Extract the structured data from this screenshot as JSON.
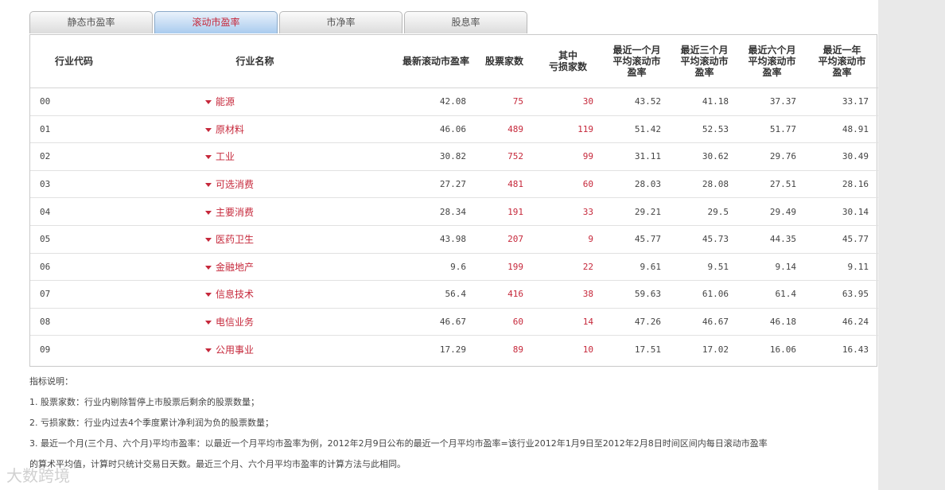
{
  "tabs": [
    {
      "label": "静态市盈率",
      "active": false
    },
    {
      "label": "滚动市盈率",
      "active": true
    },
    {
      "label": "市净率",
      "active": false
    },
    {
      "label": "股息率",
      "active": false
    }
  ],
  "table": {
    "headers": {
      "code": "行业代码",
      "name": "行业名称",
      "latest_pe": "最新滚动市盈率",
      "stock_count": "股票家数",
      "loss_count_1": "其中",
      "loss_count_2": "亏损家数",
      "m1_1": "最近一个月",
      "m1_2": "平均滚动市",
      "m1_3": "盈率",
      "m3_1": "最近三个月",
      "m3_2": "平均滚动市",
      "m3_3": "盈率",
      "m6_1": "最近六个月",
      "m6_2": "平均滚动市",
      "m6_3": "盈率",
      "y1_1": "最近一年",
      "y1_2": "平均滚动市",
      "y1_3": "盈率"
    },
    "rows": [
      {
        "code": "00",
        "name": "能源",
        "pe": "42.08",
        "count": "75",
        "loss": "30",
        "m1": "43.52",
        "m3": "41.18",
        "m6": "37.37",
        "y1": "33.17"
      },
      {
        "code": "01",
        "name": "原材料",
        "pe": "46.06",
        "count": "489",
        "loss": "119",
        "m1": "51.42",
        "m3": "52.53",
        "m6": "51.77",
        "y1": "48.91"
      },
      {
        "code": "02",
        "name": "工业",
        "pe": "30.82",
        "count": "752",
        "loss": "99",
        "m1": "31.11",
        "m3": "30.62",
        "m6": "29.76",
        "y1": "30.49"
      },
      {
        "code": "03",
        "name": "可选消费",
        "pe": "27.27",
        "count": "481",
        "loss": "60",
        "m1": "28.03",
        "m3": "28.08",
        "m6": "27.51",
        "y1": "28.16"
      },
      {
        "code": "04",
        "name": "主要消费",
        "pe": "28.34",
        "count": "191",
        "loss": "33",
        "m1": "29.21",
        "m3": "29.5",
        "m6": "29.49",
        "y1": "30.14"
      },
      {
        "code": "05",
        "name": "医药卫生",
        "pe": "43.98",
        "count": "207",
        "loss": "9",
        "m1": "45.77",
        "m3": "45.73",
        "m6": "44.35",
        "y1": "45.77"
      },
      {
        "code": "06",
        "name": "金融地产",
        "pe": "9.6",
        "count": "199",
        "loss": "22",
        "m1": "9.61",
        "m3": "9.51",
        "m6": "9.14",
        "y1": "9.11"
      },
      {
        "code": "07",
        "name": "信息技术",
        "pe": "56.4",
        "count": "416",
        "loss": "38",
        "m1": "59.63",
        "m3": "61.06",
        "m6": "61.4",
        "y1": "63.95"
      },
      {
        "code": "08",
        "name": "电信业务",
        "pe": "46.67",
        "count": "60",
        "loss": "14",
        "m1": "47.26",
        "m3": "46.67",
        "m6": "46.18",
        "y1": "46.24"
      },
      {
        "code": "09",
        "name": "公用事业",
        "pe": "17.29",
        "count": "89",
        "loss": "10",
        "m1": "17.51",
        "m3": "17.02",
        "m6": "16.06",
        "y1": "16.43"
      }
    ]
  },
  "notes": {
    "title": "指标说明：",
    "items": [
      "1. 股票家数：行业内剔除暂停上市股票后剩余的股票数量；",
      "2. 亏损家数：行业内过去4个季度累计净利润为负的股票数量；",
      "3. 最近一个月(三个月、六个月)平均市盈率：以最近一个月平均市盈率为例，2012年2月9日公布的最近一个月平均市盈率=该行业2012年1月9日至2012年2月8日时间区间内每日滚动市盈率",
      "的算术平均值，计算时只统计交易日天数。最近三个月、六个月平均市盈率的计算方法与此相同。"
    ]
  },
  "watermark": "大数跨境",
  "colors": {
    "accent": "#c6283b",
    "tab_active": "#a9cbee",
    "panel": "#e9e9e9"
  }
}
